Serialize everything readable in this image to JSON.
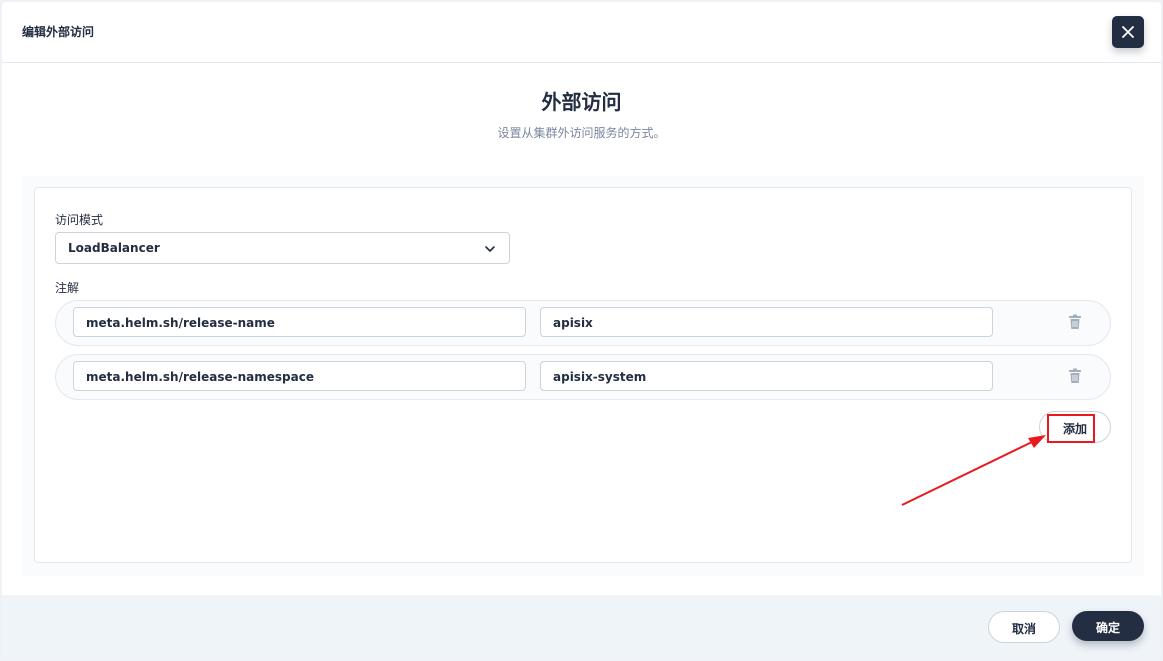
{
  "header": {
    "title": "编辑外部访问"
  },
  "main": {
    "title": "外部访问",
    "description": "设置从集群外访问服务的方式。"
  },
  "form": {
    "access_mode_label": "访问模式",
    "access_mode_value": "LoadBalancer",
    "annotations_label": "注解",
    "annotations": [
      {
        "key": "meta.helm.sh/release-name",
        "value": "apisix"
      },
      {
        "key": "meta.helm.sh/release-namespace",
        "value": "apisix-system"
      }
    ],
    "add_label": "添加"
  },
  "footer": {
    "cancel_label": "取消",
    "ok_label": "确定"
  },
  "colors": {
    "primary_dark": "#242e42",
    "highlight_red": "#e8191f"
  },
  "icons": {
    "close": "close-icon",
    "caret": "chevron-down-icon",
    "delete": "trash-icon"
  }
}
